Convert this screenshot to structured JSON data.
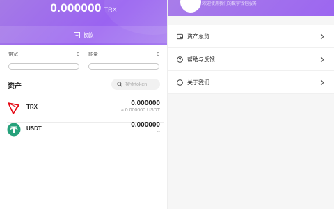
{
  "wallet": {
    "balance": "0.000000",
    "balance_unit": "TRX",
    "receive_label": "收款"
  },
  "resources": [
    {
      "label": "带宽",
      "value": "0"
    },
    {
      "label": "能量",
      "value": "0"
    }
  ],
  "assets": {
    "title": "资产",
    "search_placeholder": "搜索token",
    "tokens": [
      {
        "symbol": "TRX",
        "amount": "0.000000",
        "fiat": "≈ 0.000000 USDT",
        "icon": "tron-logo-icon",
        "color": "#e50914"
      },
      {
        "symbol": "USDT",
        "amount": "0.000000",
        "fiat": "--",
        "icon": "tether-logo-icon",
        "color": "#26a17b"
      }
    ]
  },
  "profile": {
    "subtitle": "欢迎使用我们的数字钱包服务"
  },
  "menu": {
    "items": [
      {
        "label": "资产总览",
        "icon": "wallet-icon"
      },
      {
        "label": "帮助与反馈",
        "icon": "help-icon"
      },
      {
        "label": "关于我们",
        "icon": "info-icon"
      }
    ]
  },
  "colors": {
    "accent": "#9c66f0",
    "background": "#f6f6f6"
  }
}
